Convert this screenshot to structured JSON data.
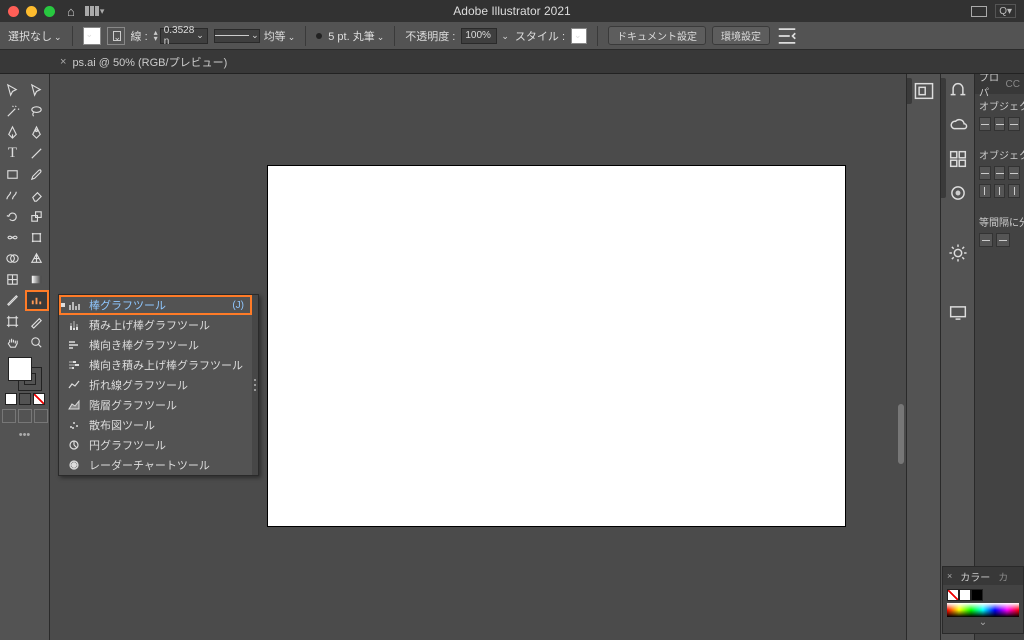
{
  "app": {
    "title": "Adobe Illustrator 2021"
  },
  "controlbar": {
    "selection": "選択なし",
    "stroke_label": "線 :",
    "stroke_value": "0.3528 n",
    "uniform": "均等",
    "brush_label": "5 pt. 丸筆",
    "opacity_label": "不透明度 :",
    "opacity_value": "100%",
    "style_label": "スタイル :",
    "doc_settings": "ドキュメント設定",
    "prefs": "環境設定"
  },
  "tab": {
    "label": "ps.ai @ 50% (RGB/プレビュー)"
  },
  "flyout": {
    "items": [
      {
        "label": "棒グラフツール",
        "shortcut": "(J)",
        "selected": true
      },
      {
        "label": "積み上げ棒グラフツール"
      },
      {
        "label": "横向き棒グラフツール"
      },
      {
        "label": "横向き積み上げ棒グラフツール"
      },
      {
        "label": "折れ線グラフツール"
      },
      {
        "label": "階層グラフツール"
      },
      {
        "label": "散布図ツール"
      },
      {
        "label": "円グラフツール"
      },
      {
        "label": "レーダーチャートツール"
      }
    ]
  },
  "right_panel": {
    "tab1": "プロパ",
    "tab2": "CC",
    "sect1": "オブジェク",
    "sect2": "オブジェク",
    "sect3": "等間隔に分"
  },
  "color_panel": {
    "title": "カラー",
    "tab2": "カ"
  },
  "titlebar_search": "Q"
}
